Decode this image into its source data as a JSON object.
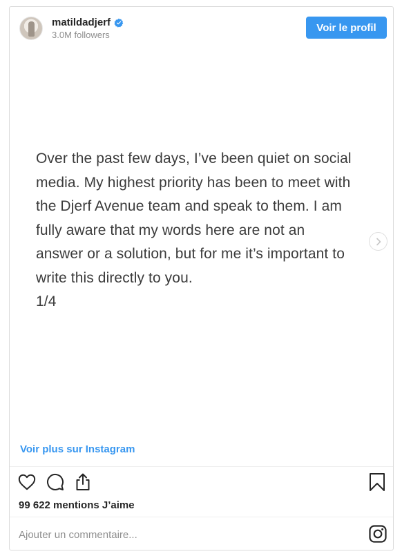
{
  "header": {
    "username": "matildadjerf",
    "followers": "3.0M followers",
    "profile_button": "Voir le profil",
    "verified_color": "#3897f0",
    "avatar_icon": "avatar"
  },
  "post": {
    "text": "Over the past few days, I’ve been quiet on social\nmedia. My highest priority has been to meet with\nthe Djerf Avenue team and speak to them. I am\nfully aware that my words here are not an\nanswer or a solution, but for me it’s important to\nwrite this directly to you.\n1/4",
    "next_icon": "chevron-right-icon"
  },
  "footer": {
    "view_more": "Voir plus sur Instagram",
    "likes": "99 622 mentions J’aime",
    "comment_placeholder": "Ajouter un commentaire...",
    "icons": [
      "heart-icon",
      "comment-icon",
      "share-icon",
      "bookmark-icon",
      "instagram-icon"
    ]
  },
  "colors": {
    "accent": "#3897f0",
    "text": "#262626",
    "muted": "#8e8e8e",
    "border": "#dbdbdb"
  }
}
